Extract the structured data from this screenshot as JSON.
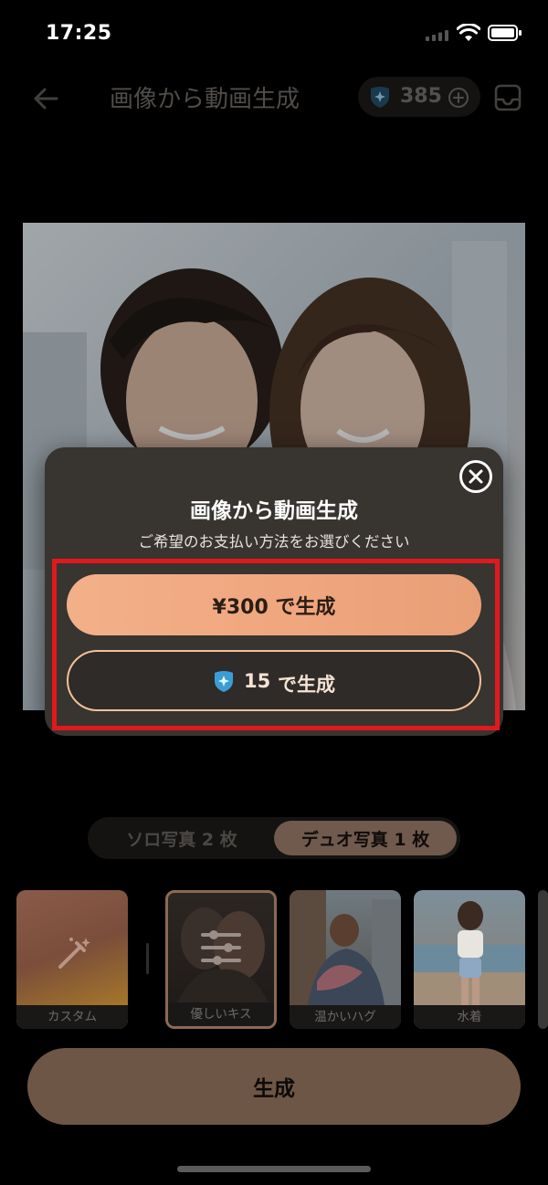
{
  "status_bar": {
    "time": "17:25"
  },
  "header": {
    "title": "画像から動画生成",
    "credits": "385",
    "icons": {
      "back": "back-arrow-icon",
      "credit": "credit-badge-icon",
      "add": "plus-circle-icon",
      "inbox": "inbox-icon"
    }
  },
  "modal": {
    "title": "画像から動画生成",
    "subtitle": "ご希望のお支払い方法をお選びください",
    "pay_yen_label": "¥300 で生成",
    "pay_credit_amount": "15",
    "pay_credit_suffix": "で生成",
    "highlight_color": "#e0191c"
  },
  "segment": {
    "solo": "ソロ写真 2 枚",
    "duo": "デュオ写真 1 枚",
    "selected": "duo"
  },
  "templates": [
    {
      "label": "カスタム"
    },
    {
      "label": "優しいキス",
      "selected": true
    },
    {
      "label": "温かいハグ"
    },
    {
      "label": "水着"
    }
  ],
  "generate_label": "生成",
  "colors": {
    "accent": "#f0a67e",
    "button": "#6e5646",
    "background": "#000000"
  }
}
